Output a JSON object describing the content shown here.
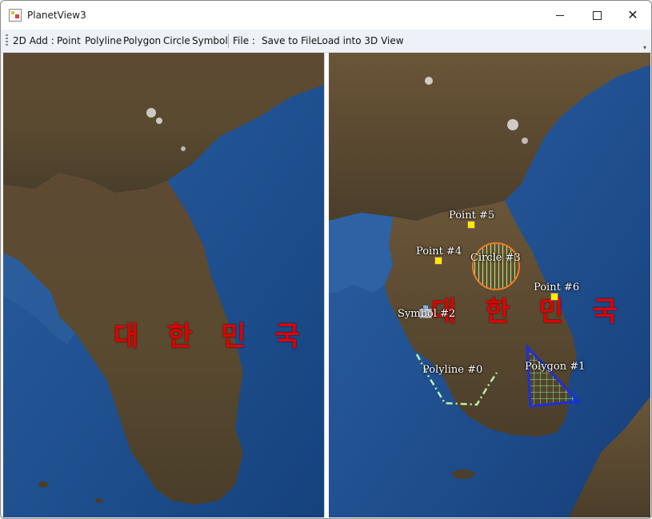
{
  "window": {
    "title": "PlanetView3"
  },
  "toolbar": {
    "add_label": "2D Add :",
    "point": "Point",
    "polyline": "Polyline",
    "polygon": "Polygon",
    "circle": "Circle",
    "symbol": "Symbol",
    "file_label": "File :",
    "save": "Save to File",
    "load": "Load into 3D View"
  },
  "left_map": {
    "label": "대 한 민 국"
  },
  "right_map": {
    "label": "대 한 민 국",
    "point5": "Point #5",
    "point4": "Point #4",
    "circle3": "Circle #3",
    "point6": "Point #6",
    "symbol2": "Symbol #2",
    "polyline0": "Polyline #0",
    "polygon1": "Polygon #1"
  },
  "colors": {
    "sea": "#1b4c8a",
    "land": "#5a4a32",
    "label_red": "#e00000",
    "point_yellow": "#ffea00",
    "circle_orange": "#e87d2a",
    "polygon_blue": "#1b2fe0",
    "polyline_green": "#b9f3a7"
  }
}
